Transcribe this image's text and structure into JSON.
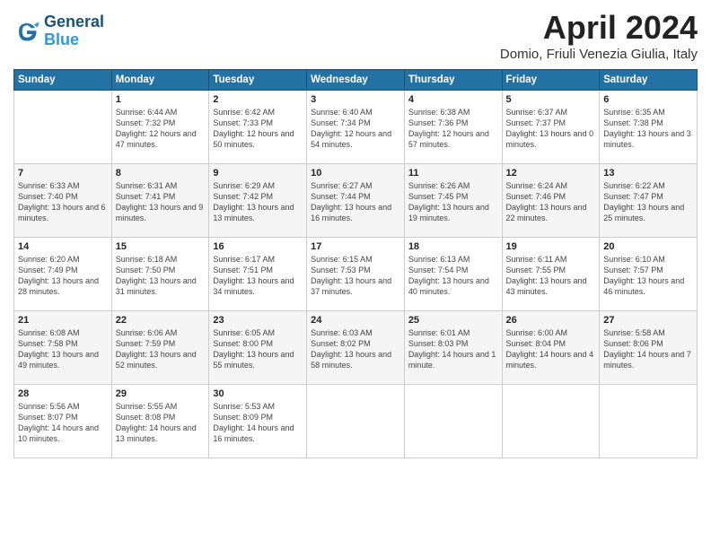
{
  "header": {
    "logo_line1": "General",
    "logo_line2": "Blue",
    "month_title": "April 2024",
    "subtitle": "Domio, Friuli Venezia Giulia, Italy"
  },
  "days_of_week": [
    "Sunday",
    "Monday",
    "Tuesday",
    "Wednesday",
    "Thursday",
    "Friday",
    "Saturday"
  ],
  "weeks": [
    [
      {
        "day": "",
        "sunrise": "",
        "sunset": "",
        "daylight": ""
      },
      {
        "day": "1",
        "sunrise": "Sunrise: 6:44 AM",
        "sunset": "Sunset: 7:32 PM",
        "daylight": "Daylight: 12 hours and 47 minutes."
      },
      {
        "day": "2",
        "sunrise": "Sunrise: 6:42 AM",
        "sunset": "Sunset: 7:33 PM",
        "daylight": "Daylight: 12 hours and 50 minutes."
      },
      {
        "day": "3",
        "sunrise": "Sunrise: 6:40 AM",
        "sunset": "Sunset: 7:34 PM",
        "daylight": "Daylight: 12 hours and 54 minutes."
      },
      {
        "day": "4",
        "sunrise": "Sunrise: 6:38 AM",
        "sunset": "Sunset: 7:36 PM",
        "daylight": "Daylight: 12 hours and 57 minutes."
      },
      {
        "day": "5",
        "sunrise": "Sunrise: 6:37 AM",
        "sunset": "Sunset: 7:37 PM",
        "daylight": "Daylight: 13 hours and 0 minutes."
      },
      {
        "day": "6",
        "sunrise": "Sunrise: 6:35 AM",
        "sunset": "Sunset: 7:38 PM",
        "daylight": "Daylight: 13 hours and 3 minutes."
      }
    ],
    [
      {
        "day": "7",
        "sunrise": "Sunrise: 6:33 AM",
        "sunset": "Sunset: 7:40 PM",
        "daylight": "Daylight: 13 hours and 6 minutes."
      },
      {
        "day": "8",
        "sunrise": "Sunrise: 6:31 AM",
        "sunset": "Sunset: 7:41 PM",
        "daylight": "Daylight: 13 hours and 9 minutes."
      },
      {
        "day": "9",
        "sunrise": "Sunrise: 6:29 AM",
        "sunset": "Sunset: 7:42 PM",
        "daylight": "Daylight: 13 hours and 13 minutes."
      },
      {
        "day": "10",
        "sunrise": "Sunrise: 6:27 AM",
        "sunset": "Sunset: 7:44 PM",
        "daylight": "Daylight: 13 hours and 16 minutes."
      },
      {
        "day": "11",
        "sunrise": "Sunrise: 6:26 AM",
        "sunset": "Sunset: 7:45 PM",
        "daylight": "Daylight: 13 hours and 19 minutes."
      },
      {
        "day": "12",
        "sunrise": "Sunrise: 6:24 AM",
        "sunset": "Sunset: 7:46 PM",
        "daylight": "Daylight: 13 hours and 22 minutes."
      },
      {
        "day": "13",
        "sunrise": "Sunrise: 6:22 AM",
        "sunset": "Sunset: 7:47 PM",
        "daylight": "Daylight: 13 hours and 25 minutes."
      }
    ],
    [
      {
        "day": "14",
        "sunrise": "Sunrise: 6:20 AM",
        "sunset": "Sunset: 7:49 PM",
        "daylight": "Daylight: 13 hours and 28 minutes."
      },
      {
        "day": "15",
        "sunrise": "Sunrise: 6:18 AM",
        "sunset": "Sunset: 7:50 PM",
        "daylight": "Daylight: 13 hours and 31 minutes."
      },
      {
        "day": "16",
        "sunrise": "Sunrise: 6:17 AM",
        "sunset": "Sunset: 7:51 PM",
        "daylight": "Daylight: 13 hours and 34 minutes."
      },
      {
        "day": "17",
        "sunrise": "Sunrise: 6:15 AM",
        "sunset": "Sunset: 7:53 PM",
        "daylight": "Daylight: 13 hours and 37 minutes."
      },
      {
        "day": "18",
        "sunrise": "Sunrise: 6:13 AM",
        "sunset": "Sunset: 7:54 PM",
        "daylight": "Daylight: 13 hours and 40 minutes."
      },
      {
        "day": "19",
        "sunrise": "Sunrise: 6:11 AM",
        "sunset": "Sunset: 7:55 PM",
        "daylight": "Daylight: 13 hours and 43 minutes."
      },
      {
        "day": "20",
        "sunrise": "Sunrise: 6:10 AM",
        "sunset": "Sunset: 7:57 PM",
        "daylight": "Daylight: 13 hours and 46 minutes."
      }
    ],
    [
      {
        "day": "21",
        "sunrise": "Sunrise: 6:08 AM",
        "sunset": "Sunset: 7:58 PM",
        "daylight": "Daylight: 13 hours and 49 minutes."
      },
      {
        "day": "22",
        "sunrise": "Sunrise: 6:06 AM",
        "sunset": "Sunset: 7:59 PM",
        "daylight": "Daylight: 13 hours and 52 minutes."
      },
      {
        "day": "23",
        "sunrise": "Sunrise: 6:05 AM",
        "sunset": "Sunset: 8:00 PM",
        "daylight": "Daylight: 13 hours and 55 minutes."
      },
      {
        "day": "24",
        "sunrise": "Sunrise: 6:03 AM",
        "sunset": "Sunset: 8:02 PM",
        "daylight": "Daylight: 13 hours and 58 minutes."
      },
      {
        "day": "25",
        "sunrise": "Sunrise: 6:01 AM",
        "sunset": "Sunset: 8:03 PM",
        "daylight": "Daylight: 14 hours and 1 minute."
      },
      {
        "day": "26",
        "sunrise": "Sunrise: 6:00 AM",
        "sunset": "Sunset: 8:04 PM",
        "daylight": "Daylight: 14 hours and 4 minutes."
      },
      {
        "day": "27",
        "sunrise": "Sunrise: 5:58 AM",
        "sunset": "Sunset: 8:06 PM",
        "daylight": "Daylight: 14 hours and 7 minutes."
      }
    ],
    [
      {
        "day": "28",
        "sunrise": "Sunrise: 5:56 AM",
        "sunset": "Sunset: 8:07 PM",
        "daylight": "Daylight: 14 hours and 10 minutes."
      },
      {
        "day": "29",
        "sunrise": "Sunrise: 5:55 AM",
        "sunset": "Sunset: 8:08 PM",
        "daylight": "Daylight: 14 hours and 13 minutes."
      },
      {
        "day": "30",
        "sunrise": "Sunrise: 5:53 AM",
        "sunset": "Sunset: 8:09 PM",
        "daylight": "Daylight: 14 hours and 16 minutes."
      },
      {
        "day": "",
        "sunrise": "",
        "sunset": "",
        "daylight": ""
      },
      {
        "day": "",
        "sunrise": "",
        "sunset": "",
        "daylight": ""
      },
      {
        "day": "",
        "sunrise": "",
        "sunset": "",
        "daylight": ""
      },
      {
        "day": "",
        "sunrise": "",
        "sunset": "",
        "daylight": ""
      }
    ]
  ]
}
